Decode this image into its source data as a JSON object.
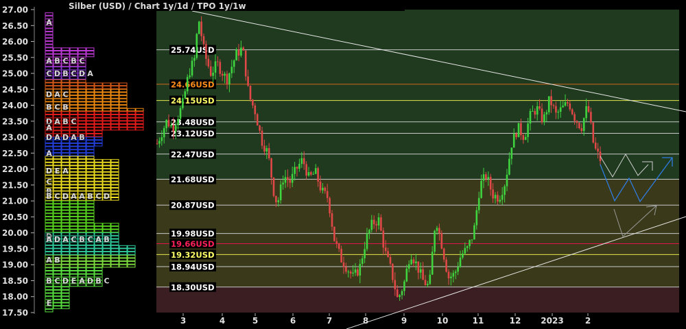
{
  "chart_data": {
    "type": "candlestick",
    "title": "Silber (USD) /  Chart 1y/1d / TPO 1y/1w",
    "ylim": [
      17.5,
      27.0
    ],
    "yticks": [
      "27.00",
      "26.50",
      "26.00",
      "25.50",
      "25.00",
      "24.50",
      "24.00",
      "23.50",
      "23.00",
      "22.50",
      "22.00",
      "21.50",
      "21.00",
      "20.50",
      "20.00",
      "19.50",
      "19.00",
      "18.50",
      "18.00",
      "17.50"
    ],
    "xticks": [
      "3",
      "4",
      "5",
      "6",
      "7",
      "8",
      "9",
      "10",
      "11",
      "12",
      "2023",
      "2"
    ],
    "levels": [
      {
        "value": 25.74,
        "label": "25.74USD",
        "color": "#ffffff",
        "lineColor": "#c8c8c8"
      },
      {
        "value": 24.66,
        "label": "24.66USD",
        "color": "#ff8c1a",
        "lineColor": "#d2691e"
      },
      {
        "value": 24.15,
        "label": "24.15USD",
        "color": "#ffff66",
        "lineColor": "#e6e64d"
      },
      {
        "value": 23.48,
        "label": "23.48USD",
        "color": "#ffffff",
        "lineColor": "#c8c8c8"
      },
      {
        "value": 23.12,
        "label": "23.12USD",
        "color": "#ffffff",
        "lineColor": "#c8c8c8"
      },
      {
        "value": 22.47,
        "label": "22.47USD",
        "color": "#ffffff",
        "lineColor": "#c8c8c8"
      },
      {
        "value": 21.68,
        "label": "21.68USD",
        "color": "#ffffff",
        "lineColor": "#c8c8c8"
      },
      {
        "value": 20.87,
        "label": "20.87USD",
        "color": "#ffffff",
        "lineColor": "#c8c8c8"
      },
      {
        "value": 19.98,
        "label": "19.98USD",
        "color": "#ffffff",
        "lineColor": "#c8c8c8"
      },
      {
        "value": 19.66,
        "label": "19.66USD",
        "color": "#ff1f5a",
        "lineColor": "#e0144c"
      },
      {
        "value": 19.32,
        "label": "19.32USD",
        "color": "#ffff66",
        "lineColor": "#e6e64d"
      },
      {
        "value": 18.94,
        "label": "18.94USD",
        "color": "#ffffff",
        "lineColor": "#c8c8c8"
      },
      {
        "value": 18.3,
        "label": "18.30USD",
        "color": "#ffffff",
        "lineColor": "#c8c8c8"
      }
    ],
    "zones": [
      {
        "from": 21.68,
        "to": 27.0,
        "color": "#1f3a1f"
      },
      {
        "from": 18.3,
        "to": 21.68,
        "color": "#3a3a1a"
      },
      {
        "from": 17.5,
        "to": 18.3,
        "color": "#3a1e22"
      }
    ],
    "price_path": [
      {
        "x": 0,
        "y": 22.8
      },
      {
        "x": 3,
        "y": 23.5
      },
      {
        "x": 5,
        "y": 23.3
      },
      {
        "x": 8,
        "y": 24.0
      },
      {
        "x": 10,
        "y": 25.0
      },
      {
        "x": 12,
        "y": 25.5
      },
      {
        "x": 13,
        "y": 26.8
      },
      {
        "x": 15,
        "y": 25.6
      },
      {
        "x": 17,
        "y": 25.0
      },
      {
        "x": 19,
        "y": 25.3
      },
      {
        "x": 22,
        "y": 24.8
      },
      {
        "x": 25,
        "y": 25.6
      },
      {
        "x": 27,
        "y": 25.8
      },
      {
        "x": 29,
        "y": 24.3
      },
      {
        "x": 31,
        "y": 23.8
      },
      {
        "x": 33,
        "y": 22.9
      },
      {
        "x": 35,
        "y": 22.5
      },
      {
        "x": 37,
        "y": 21.2
      },
      {
        "x": 38,
        "y": 20.9
      },
      {
        "x": 40,
        "y": 21.8
      },
      {
        "x": 42,
        "y": 21.6
      },
      {
        "x": 44,
        "y": 22.0
      },
      {
        "x": 46,
        "y": 22.3
      },
      {
        "x": 48,
        "y": 21.7
      },
      {
        "x": 50,
        "y": 21.9
      },
      {
        "x": 52,
        "y": 21.3
      },
      {
        "x": 54,
        "y": 21.1
      },
      {
        "x": 56,
        "y": 19.8
      },
      {
        "x": 58,
        "y": 19.2
      },
      {
        "x": 60,
        "y": 18.9
      },
      {
        "x": 62,
        "y": 18.6
      },
      {
        "x": 64,
        "y": 18.9
      },
      {
        "x": 66,
        "y": 19.8
      },
      {
        "x": 68,
        "y": 20.3
      },
      {
        "x": 70,
        "y": 20.4
      },
      {
        "x": 72,
        "y": 19.4
      },
      {
        "x": 74,
        "y": 18.8
      },
      {
        "x": 76,
        "y": 17.9
      },
      {
        "x": 78,
        "y": 18.4
      },
      {
        "x": 80,
        "y": 19.4
      },
      {
        "x": 82,
        "y": 19.0
      },
      {
        "x": 84,
        "y": 18.5
      },
      {
        "x": 86,
        "y": 18.3
      },
      {
        "x": 88,
        "y": 20.5
      },
      {
        "x": 90,
        "y": 19.6
      },
      {
        "x": 92,
        "y": 18.6
      },
      {
        "x": 94,
        "y": 18.7
      },
      {
        "x": 96,
        "y": 19.3
      },
      {
        "x": 98,
        "y": 19.5
      },
      {
        "x": 100,
        "y": 20.0
      },
      {
        "x": 102,
        "y": 21.5
      },
      {
        "x": 104,
        "y": 21.8
      },
      {
        "x": 106,
        "y": 21.2
      },
      {
        "x": 108,
        "y": 21.1
      },
      {
        "x": 110,
        "y": 21.6
      },
      {
        "x": 112,
        "y": 22.8
      },
      {
        "x": 114,
        "y": 23.3
      },
      {
        "x": 116,
        "y": 23.0
      },
      {
        "x": 118,
        "y": 23.7
      },
      {
        "x": 120,
        "y": 23.9
      },
      {
        "x": 122,
        "y": 23.5
      },
      {
        "x": 124,
        "y": 24.2
      },
      {
        "x": 126,
        "y": 23.7
      },
      {
        "x": 128,
        "y": 23.9
      },
      {
        "x": 130,
        "y": 24.1
      },
      {
        "x": 132,
        "y": 23.6
      },
      {
        "x": 134,
        "y": 23.3
      },
      {
        "x": 136,
        "y": 24.0
      },
      {
        "x": 138,
        "y": 22.7
      },
      {
        "x": 140,
        "y": 22.3
      }
    ],
    "tpo_letters": [
      {
        "price": 26.6,
        "text": "A"
      },
      {
        "price": 25.0,
        "text": "CDBCDA"
      },
      {
        "price": 25.4,
        "text": "ABCBC"
      },
      {
        "price": 24.35,
        "text": "DAC"
      },
      {
        "price": 23.95,
        "text": "BCB"
      },
      {
        "price": 23.5,
        "text": "DABC"
      },
      {
        "price": 23.3,
        "text": "A"
      },
      {
        "price": 23.0,
        "text": "DADAB"
      },
      {
        "price": 22.5,
        "text": "A"
      },
      {
        "price": 21.95,
        "text": "DEA"
      },
      {
        "price": 21.6,
        "text": "C"
      },
      {
        "price": 21.3,
        "text": "B"
      },
      {
        "price": 21.15,
        "text": "BCDAABCD"
      },
      {
        "price": 19.9,
        "text": "D"
      },
      {
        "price": 19.8,
        "text": "ADACBCAB"
      },
      {
        "price": 19.15,
        "text": "AB"
      },
      {
        "price": 18.5,
        "text": "BCDEADBC"
      },
      {
        "price": 17.8,
        "text": "E"
      }
    ]
  }
}
